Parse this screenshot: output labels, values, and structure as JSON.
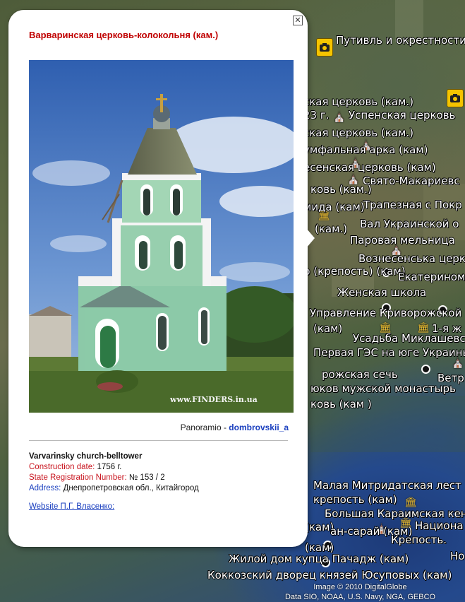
{
  "balloon": {
    "title": "Варваринская церковь-колокольня (кам.)",
    "photo_watermark": "www.FINDERS.in.ua",
    "credit_source": "Panoramio",
    "credit_separator": " - ",
    "credit_author": "dombrovskii_a",
    "info_heading": "Varvarinsky church-belltower",
    "construction_label": "Construction date:",
    "construction_value": " 1756 г.",
    "registration_label": "State Registration Number:",
    "registration_value": " № 153 / 2",
    "address_label": "Address:",
    "address_value": " Днепропетровская обл., Китайгород",
    "website_link": "Website П.Г. Власенко:"
  },
  "map": {
    "labels": [
      "Путивль и окрестности",
      "ская церковь (кам.)",
      "23 г.",
      "Успенская церковь",
      "ская церковь (кам.)",
      "умфальная арка (кам)",
      "есенская церковь (кам)",
      "Свято-Макариевс",
      "ковь (кам.)",
      "Трапезная с Покр",
      "мида (кам)",
      "Вал Украинской о",
      "(кам.)",
      "Паровая мельница",
      "Вознесенська церк",
      "р (крепость) (кам)",
      "Екатерином",
      "Женская школа",
      "Управление Криворожской",
      "(кам)",
      "1-я ж",
      "Усадьба Миклашевских",
      "Первая ГЭС на юге Украины",
      "Ветр",
      "рожская сечь",
      "юков мужской монастырь",
      "ковь (кам )",
      "Малая Митридатская лест",
      "крепость (кам)",
      "Большая Караимская кенас",
      "(кам)",
      "Национа",
      "ан-сарай (кам)",
      "Крепость.",
      "Но",
      "(кам)",
      "Жилой дом купца Пачадж (кам)",
      "Коккозский дворец князей Юсуповых (кам)"
    ],
    "attribution_line1": "Image © 2010 DigitalGlobe",
    "attribution_line2": "Data SIO, NOAA, U.S. Navy, NGA, GEBCO"
  },
  "colors": {
    "title_red": "#c00000",
    "label_red": "#c8141e",
    "link_blue": "#1a3fbf"
  },
  "icons": [
    "close-icon",
    "camera-icon",
    "landmark-icon"
  ]
}
